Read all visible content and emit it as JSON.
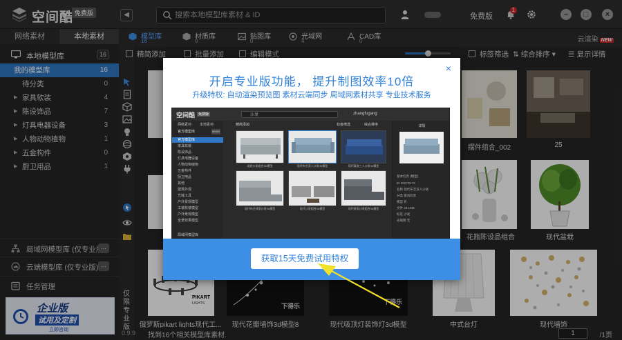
{
  "app": {
    "logo_text": "空间酷",
    "edition": "免费版",
    "search_placeholder": "搜索本地模型库素材 & ID",
    "free_version_label": "免费版",
    "notification_count": "1",
    "brand_color": "#2f78c5",
    "accent_color": "#3d8fe6"
  },
  "left_tabs": [
    {
      "label": "网络素材",
      "active": false
    },
    {
      "label": "本地素材",
      "active": true
    }
  ],
  "sidebar": {
    "header_label": "本地模型库",
    "header_count": "16",
    "items": [
      {
        "label": "我的模型库",
        "count": "16",
        "selected": true,
        "expandable": false
      },
      {
        "label": "待分类",
        "count": "0",
        "selected": false,
        "expandable": false
      },
      {
        "label": "家具软装",
        "count": "4",
        "selected": false,
        "expandable": true
      },
      {
        "label": "陈设饰品",
        "count": "7",
        "selected": false,
        "expandable": true
      },
      {
        "label": "灯具电器设备",
        "count": "3",
        "selected": false,
        "expandable": true
      },
      {
        "label": "人物动物植物",
        "count": "1",
        "selected": false,
        "expandable": true
      },
      {
        "label": "五金构件",
        "count": "0",
        "selected": false,
        "expandable": true
      },
      {
        "label": "厨卫用品",
        "count": "1",
        "selected": false,
        "expandable": true
      }
    ],
    "bottom": [
      {
        "label": "局域网模型库 (仅专业版)",
        "icon": "network-icon",
        "has_more": true
      },
      {
        "label": "云端模型库 (仅专业版)",
        "icon": "cloud-icon",
        "has_more": true
      },
      {
        "label": "任务管理",
        "icon": "task-icon",
        "has_more": false
      }
    ],
    "more_label": "...",
    "promo": {
      "line1": "企业版",
      "line2": "试用及定制",
      "line3": "立即咨询"
    }
  },
  "toolstrip": {
    "vertical_text": "仅限专业版",
    "version": "0.9.92"
  },
  "categories": [
    {
      "label": "模型库",
      "count": "16",
      "active": true,
      "icon": "cube-icon"
    },
    {
      "label": "材质库",
      "count": "0",
      "active": false,
      "icon": "material-icon"
    },
    {
      "label": "贴图库",
      "count": "0",
      "active": false,
      "icon": "image-icon"
    },
    {
      "label": "光域网",
      "count": "4",
      "active": false,
      "icon": "light-icon"
    },
    {
      "label": "CAD库",
      "count": "0",
      "active": false,
      "icon": "cad-icon"
    }
  ],
  "cloud_render": {
    "label": "云渲染",
    "badge": "NEW"
  },
  "toolbar": {
    "batch_add": "批量添加",
    "fine_add": "精简添加",
    "edit_mode": "编辑模式",
    "tag_filter": "标签筛选",
    "sort": "综合排序",
    "show_detail": "显示详情",
    "zoom_fraction": 0.5
  },
  "grid": {
    "labels": [
      "摆件组合_002",
      "25",
      "花瓶陈设品组合",
      "现代盆栽",
      "俄罗斯pikart lights现代工...",
      "现代花瓣墙饰3d模型8",
      "现代吸顶灯装饰灯3d模型",
      "中式台灯",
      "现代墙饰"
    ],
    "pikart_text": [
      "PIKART",
      "LIGHTS"
    ],
    "watermark": "下得乐"
  },
  "status": {
    "found_text": "找到16个相关模型库素材.",
    "page_current": "1",
    "page_total": "/1页"
  },
  "modal": {
    "title": "开启专业版功能， 提升制图效率10倍",
    "subtitle": "升级特权: 自动渲染预览图  素材云端同步  局域网素材共享  专业技术服务",
    "trial_button": "获取15天免费试用特权",
    "close_label": "×"
  },
  "mini_screenshot": {
    "logo": "空间酷",
    "edition": "免费版",
    "search": "沙发",
    "user": "zhangfugang",
    "tabs": [
      "网络素材",
      "本地素材"
    ],
    "header": "官方模型库",
    "header_count": "80984",
    "rows": [
      "官方模型库",
      "家具软装",
      "陈设饰品",
      "灯具电器设备",
      "人物动物植物",
      "五金构件",
      "厨卫用品",
      "其他",
      "建筑外观",
      "光域工具",
      "户外景观模型",
      "工装软装模型",
      "户外景观模型",
      "全景效果模型"
    ],
    "selected_row": 1,
    "thumb_captions": [
      "北欧沙发组合3D模型",
      "现代布艺双人沙发3d模型",
      "现代真皮三人沙发3d模型",
      "现代布艺转角沙发3d模型",
      "现代沙发组合3d模型",
      "现代转角沙发组合3d模型"
    ],
    "detail_title": "详情",
    "detail_rows": [
      "基本信息 (模型)",
      "ID  3007R173",
      "名称  现代布艺双人沙发",
      "分类  家具软装",
      "模型  有",
      "文件  48.1MB",
      "标签  沙发",
      "光域网  无"
    ],
    "tag_filter": "标签筛选",
    "sort": "综合排序",
    "fine_add": "精简添加",
    "lan_label": "局域网模型库"
  }
}
